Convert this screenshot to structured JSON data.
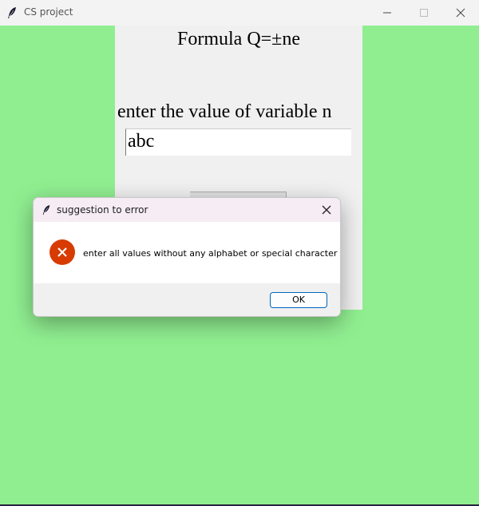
{
  "window": {
    "title": "CS project",
    "icon": "feather-icon",
    "background_color": "#90ee90",
    "controls": [
      "minimize-icon",
      "maximize-icon",
      "close-icon"
    ]
  },
  "form": {
    "formula_label": "Formula Q=±ne",
    "prompt_label": "enter the value of variable n",
    "input_value": "abc"
  },
  "dialog": {
    "title": "suggestion to error",
    "icon": "feather-icon",
    "error_icon": "error-x-icon",
    "error_color": "#d83b01",
    "message": "enter all values without any alphabet or special character",
    "ok_label": "OK"
  }
}
